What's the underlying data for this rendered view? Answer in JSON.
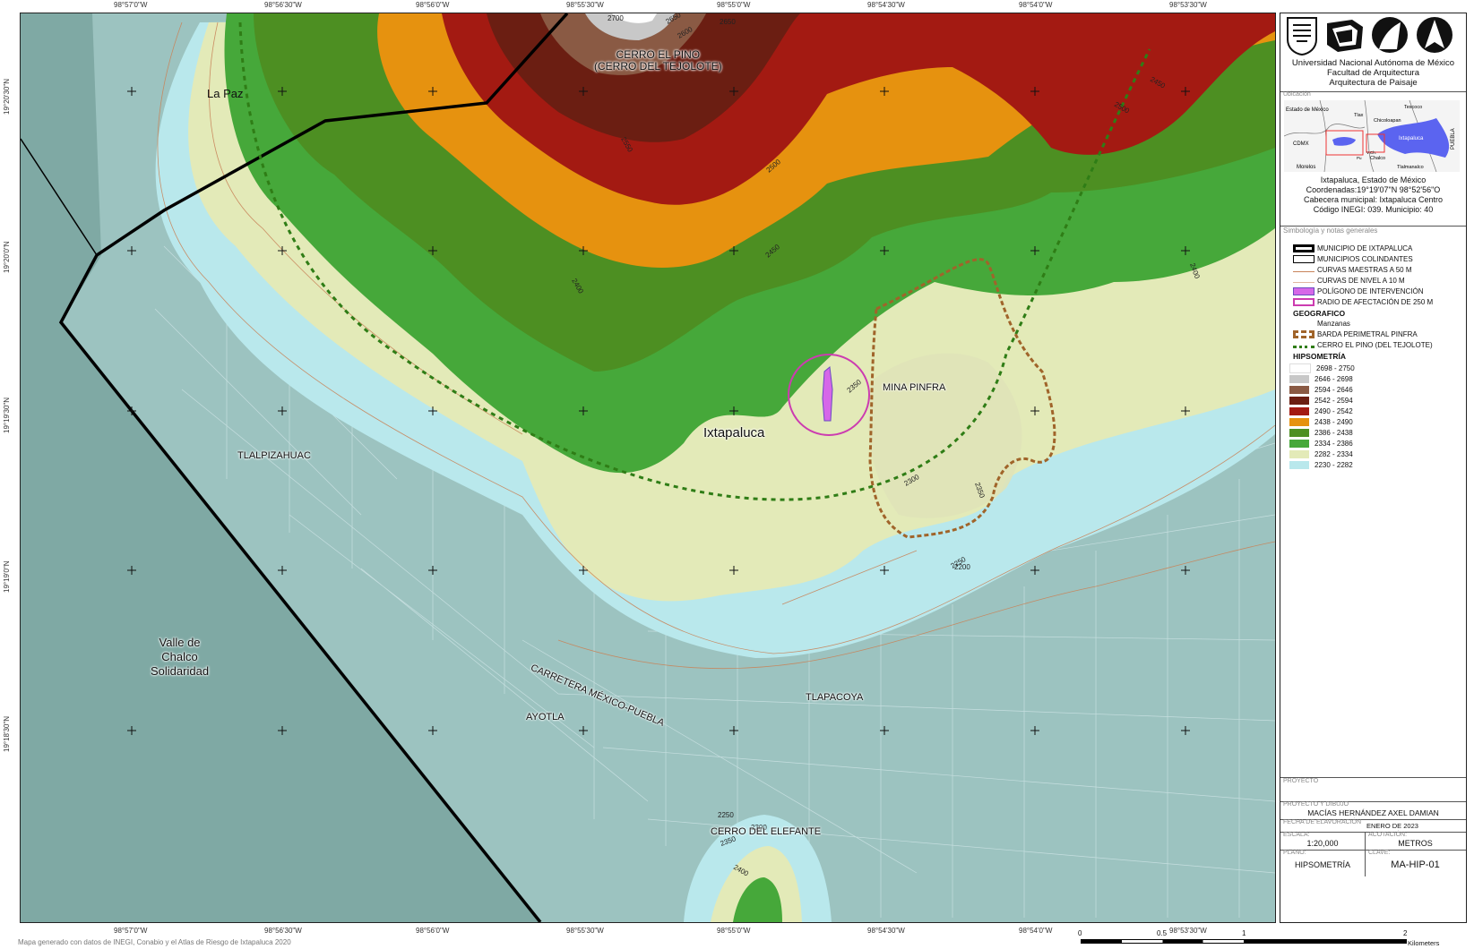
{
  "coords": {
    "top": [
      "98°57'0\"W",
      "98°56'30\"W",
      "98°56'0\"W",
      "98°55'30\"W",
      "98°55'0\"W",
      "98°54'30\"W",
      "98°54'0\"W",
      "98°53'30\"W"
    ],
    "bottom": [
      "98°57'0\"W",
      "98°56'30\"W",
      "98°56'0\"W",
      "98°55'30\"W",
      "98°55'0\"W",
      "98°54'30\"W",
      "98°54'0\"W",
      "98°53'30\"W"
    ],
    "left": [
      "19°20'30\"N",
      "19°20'0\"N",
      "19°19'30\"N",
      "19°19'0\"N",
      "19°18'30\"N"
    ]
  },
  "map_labels": {
    "la_paz": "La Paz",
    "cerro_pino_1": "CERRO EL PINO",
    "cerro_pino_2": "(CERRO DEL TEJOLOTE)",
    "mina_pinfra": "MINA PINFRA",
    "ixtapaluca": "Ixtapaluca",
    "tlalpizahuac": "TLALPIZAHUAC",
    "valle_1": "Valle de",
    "valle_2": "Chalco",
    "valle_3": "Solidaridad",
    "carretera": "CARRETERA MÉXICO-PUEBLA",
    "tlapacoya": "TLAPACOYA",
    "ayotla": "AYOTLA",
    "cerro_elefante": "CERRO DEL ELEFANTE"
  },
  "contour_labels": [
    "2700",
    "2650",
    "2600",
    "2650",
    "2550",
    "2500",
    "2450",
    "2400",
    "2350",
    "2300",
    "2250",
    "2350",
    "2400",
    "2450",
    "2500",
    "2250",
    "2300",
    "2350",
    "2400",
    "2200"
  ],
  "footer_note": "Mapa generado con datos de INEGI, Conabio y el Atlas de Riesgo de Ixtapaluca 2020",
  "panel": {
    "institution": [
      "Universidad Nacional Autónoma de México",
      "Facultad de Arquitectura",
      "Arquitectura de Paisaje"
    ],
    "ubicacion_label": "Ubicación",
    "inset_labels": {
      "estado_de_mexico": "Estado de México",
      "cdmx": "CDMX",
      "morelos": "Morelos",
      "texcoco": "Texcoco",
      "chicoloapan": "Chicoloapan",
      "ixtapaluca": "Ixtapaluca",
      "chalco": "Chalco",
      "tlalmanalco": "Tlalmanalco",
      "puebla": "PUEBLA",
      "tlax": "Tlax",
      "vc": "V.Ch.",
      "pu": "Pu"
    },
    "location_info": [
      "Ixtapaluca, Estado de México",
      "Coordenadas:19°19'07\"N 98°52'56\"O",
      "Cabecera municipal: Ixtapaluca Centro",
      "Código INEGI: 039.   Municipio: 40"
    ],
    "legend_title": "Simbología y notas generales",
    "legend_items": [
      {
        "label": "MUNICIPIO DE IXTAPALUCA"
      },
      {
        "label": "MUNICIPIOS COLINDANTES"
      },
      {
        "label": "CURVAS MAESTRAS A 50 M"
      },
      {
        "label": "CURVAS DE NIVEL A 10 M"
      },
      {
        "label": "POLÍGONO DE INTERVENCIÓN"
      },
      {
        "label": "RADIO DE AFECTACIÓN DE 250 M"
      }
    ],
    "geografico_title": "GEOGRAFICO",
    "geografico_items": [
      {
        "label": "Manzanas"
      },
      {
        "label": "BARDA PERIMETRAL PINFRA"
      },
      {
        "label": "CERRO EL PINO (DEL TEJOLOTE)"
      }
    ],
    "hipsometria_title": "HIPSOMETRÍA",
    "hipsometria": [
      {
        "range": "2698 - 2750",
        "color": "#ffffff"
      },
      {
        "range": "2646 - 2698",
        "color": "#c8c8c8"
      },
      {
        "range": "2594 - 2646",
        "color": "#8a5a44"
      },
      {
        "range": "2542 - 2594",
        "color": "#6b1e12"
      },
      {
        "range": "2490 - 2542",
        "color": "#a31a12"
      },
      {
        "range": "2438 - 2490",
        "color": "#e6920f"
      },
      {
        "range": "2386 - 2438",
        "color": "#4d8f22"
      },
      {
        "range": "2334 - 2386",
        "color": "#46a83a"
      },
      {
        "range": "2282 - 2334",
        "color": "#e3eab8"
      },
      {
        "range": "2230 - 2282",
        "color": "#b9e8ec"
      }
    ],
    "proyecto_label": "PROYECTO",
    "proyecto_dibujo_label": "PROYECTO Y DIBUJO",
    "author": "MACÍAS HERNÁNDEZ AXEL DAMIAN",
    "fecha_label": "FECHA DE ELAVORACIÓN",
    "fecha": "ENERO DE 2023",
    "escala_label": "ESCALA:",
    "escala": "1:20,000",
    "acotacion_label": "ACOTACIÓN:",
    "acotacion": "METROS",
    "plano_label": "PLANO:",
    "plano": "HIPSOMETRÍA",
    "clave_label": "CLAVE:",
    "clave": "MA-HIP-01"
  },
  "scale": {
    "ticks": [
      "0",
      "0.5",
      "1",
      "2"
    ],
    "unit": "Kilometers"
  }
}
